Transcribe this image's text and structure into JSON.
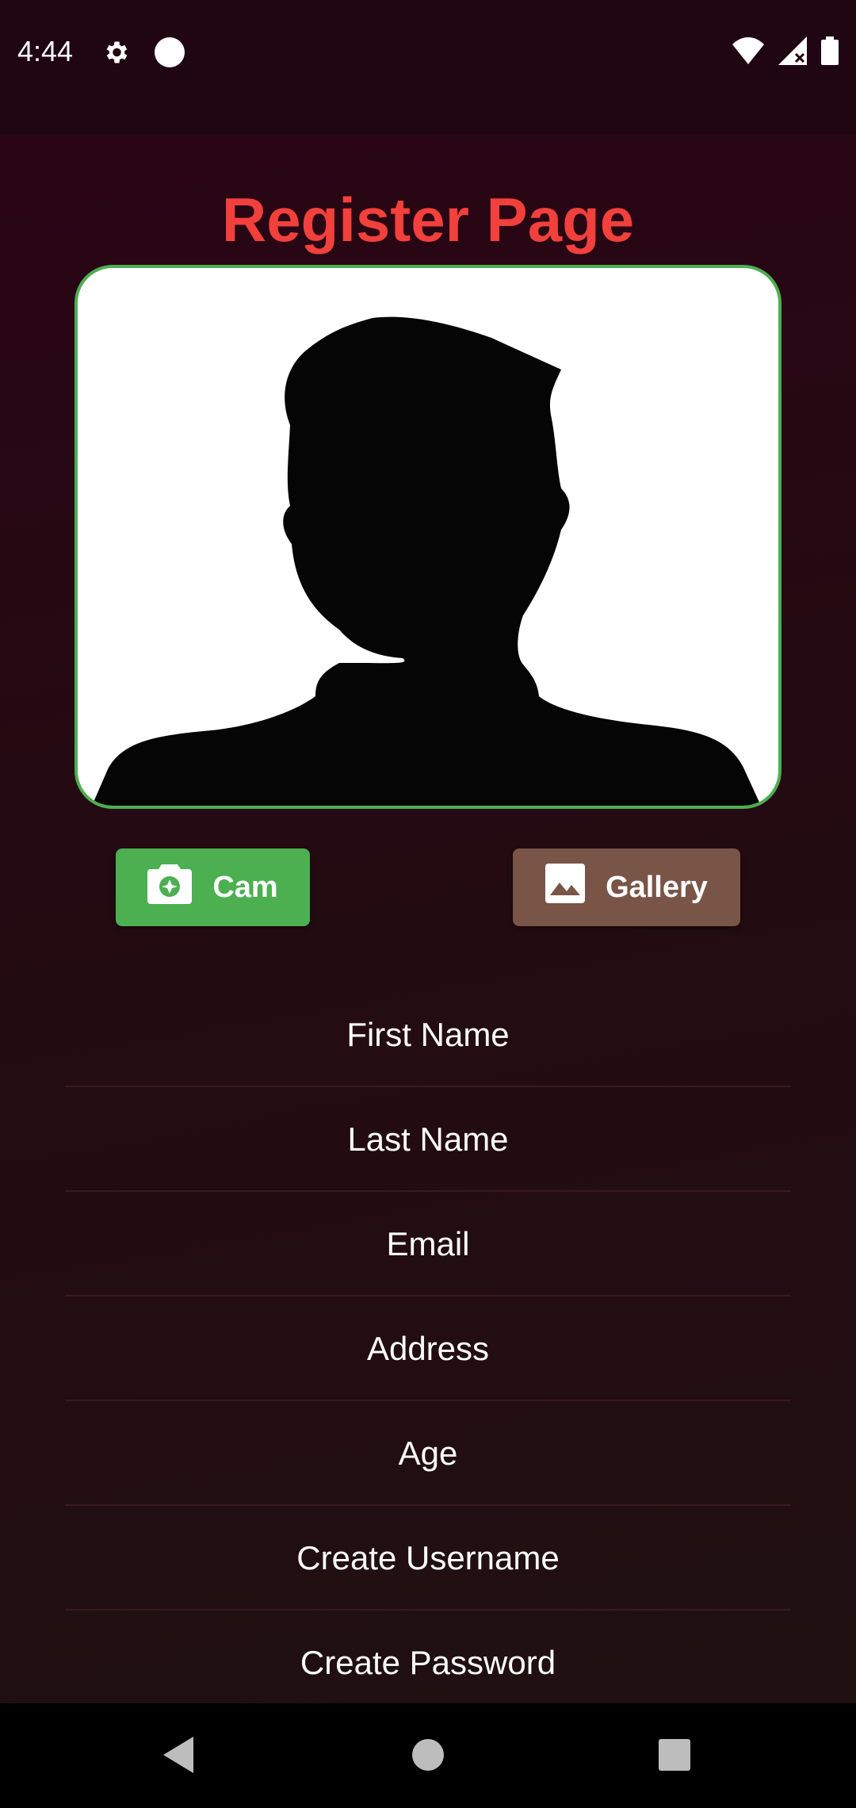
{
  "status_bar": {
    "time": "4:44",
    "icons": [
      "gear-icon",
      "circle-icon",
      "wifi-icon",
      "signal-icon",
      "battery-icon"
    ]
  },
  "page": {
    "title": "Register Page",
    "title_color": "#f2403c",
    "photo_frame_border": "#4caf50"
  },
  "buttons": {
    "cam_label": "Cam",
    "cam_color": "#4caf50",
    "gallery_label": "Gallery",
    "gallery_color": "#795548"
  },
  "form": {
    "fields": [
      {
        "placeholder": "First Name"
      },
      {
        "placeholder": "Last Name"
      },
      {
        "placeholder": "Email"
      },
      {
        "placeholder": "Address"
      },
      {
        "placeholder": "Age"
      },
      {
        "placeholder": "Create Username"
      },
      {
        "placeholder": "Create Password"
      }
    ]
  },
  "nav": {
    "icons": [
      "back-icon",
      "home-icon",
      "recents-icon"
    ]
  }
}
